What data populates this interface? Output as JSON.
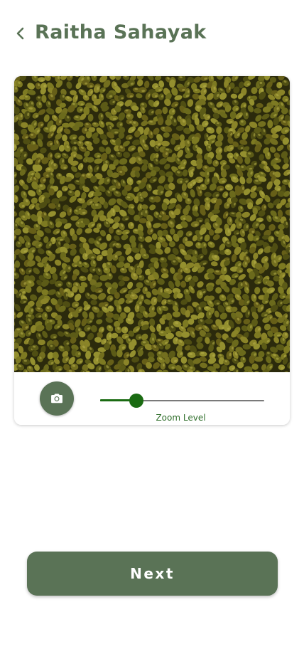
{
  "app": {
    "title": "Raitha Sahayak"
  },
  "header": {
    "back_icon": "chevron-left-icon"
  },
  "camera": {
    "preview_subject": "green gram (moong) seeds",
    "capture_icon": "camera-icon",
    "zoom": {
      "label": "Zoom Level",
      "value_fraction": 0.22
    }
  },
  "actions": {
    "next_label": "Next"
  },
  "colors": {
    "primary": "#5a7356",
    "slider_active": "#1a6b12",
    "slider_label": "#2f6e2a",
    "background": "#ffffff"
  }
}
